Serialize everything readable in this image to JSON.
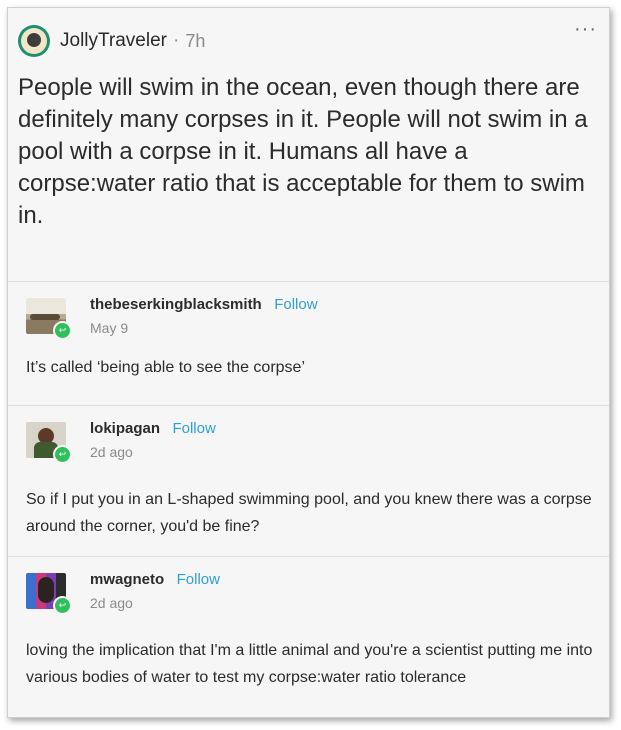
{
  "post": {
    "author": "JollyTraveler",
    "separator": "·",
    "time": "7h",
    "more_label": "···",
    "body": "People will swim in the ocean, even though there are definitely many corpses in it. People will not swim in a pool with a corpse in it. Humans all have a corpse:water ratio that is acceptable for them to swim in."
  },
  "replies": [
    {
      "username": "thebeserkingblacksmith",
      "follow_label": "Follow",
      "time": "May 9",
      "text": "It’s called ‘being able to see the corpse’"
    },
    {
      "username": "lokipagan",
      "follow_label": "Follow",
      "time": "2d ago",
      "text": "So if I put you in an L-shaped swimming pool, and you knew there was a corpse around the corner, you'd be fine?"
    },
    {
      "username": "mwagneto",
      "follow_label": "Follow",
      "time": "2d ago",
      "text": "loving the implication that I'm a little animal and you're a scientist putting me into various bodies of water to test my corpse:water ratio tolerance"
    }
  ],
  "colors": {
    "follow": "#2f9fd8",
    "badge": "#2fbf5b",
    "op_avatar": "#1e8f6f"
  }
}
